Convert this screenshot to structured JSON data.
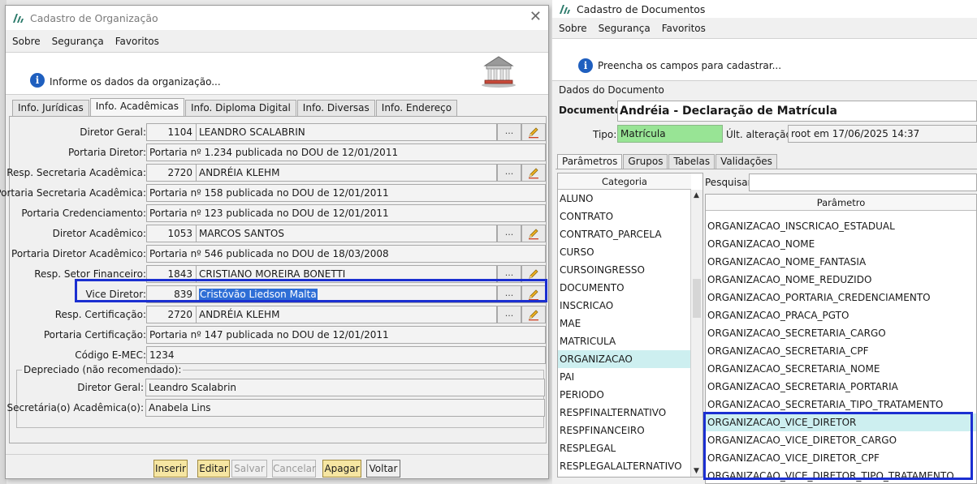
{
  "left_window": {
    "title": "Cadastro de Organização",
    "menu": [
      "Sobre",
      "Segurança",
      "Favoritos"
    ],
    "info_text": "Informe os dados da organização...",
    "tabs": [
      "Info. Jurídicas",
      "Info. Acadêmicas",
      "Info. Diploma Digital",
      "Info. Diversas",
      "Info. Endereço"
    ],
    "active_tab": "Info. Acadêmicas",
    "fields": [
      {
        "label": "Diretor Geral:",
        "code": "1104",
        "value": "LEANDRO SCALABRIN",
        "lookup": true
      },
      {
        "label": "Portaria Diretor:",
        "value": "Portaria nº 1.234 publicada no DOU de 12/01/2011",
        "lookup": false
      },
      {
        "label": "Resp. Secretaria Acadêmica:",
        "code": "2720",
        "value": "ANDRÉIA KLEHM",
        "lookup": true
      },
      {
        "label": "Portaria Secretaria Acadêmica:",
        "value": "Portaria nº 158 publicada no DOU de 12/01/2011",
        "lookup": false
      },
      {
        "label": "Portaria Credenciamento:",
        "value": "Portaria nº 123 publicada no DOU de 12/01/2011",
        "lookup": false
      },
      {
        "label": "Diretor Acadêmico:",
        "code": "1053",
        "value": "MARCOS SANTOS",
        "lookup": true
      },
      {
        "label": "Portaria Diretor Acadêmico:",
        "value": "Portaria nº 546 publicada no DOU de 18/03/2008",
        "lookup": false
      },
      {
        "label": "Resp. Setor Financeiro:",
        "code": "1843",
        "value": "CRISTIANO MOREIRA BONETTI",
        "lookup": true
      },
      {
        "label": "Vice Diretor:",
        "code": "839",
        "value": "Cristóvão Liedson Malta",
        "lookup": true,
        "selected": true
      },
      {
        "label": "Resp. Certificação:",
        "code": "2720",
        "value": "ANDRÉIA KLEHM",
        "lookup": true
      },
      {
        "label": "Portaria Certificação:",
        "value": "Portaria nº 147 publicada no DOU de 12/01/2011",
        "lookup": false
      },
      {
        "label": "Código E-MEC:",
        "value": "1234",
        "lookup": false
      }
    ],
    "lookup_button": "...",
    "deprecated": {
      "title": "Depreciado (não recomendado):",
      "fields": [
        {
          "label": "Diretor Geral:",
          "value": "Leandro Scalabrin"
        },
        {
          "label": "Secretária(o) Acadêmica(o):",
          "value": "Anabela Lins"
        }
      ]
    },
    "buttons": [
      {
        "label": "Inserir",
        "state": "highlight"
      },
      {
        "label": "Editar",
        "state": "highlight"
      },
      {
        "label": "Salvar",
        "state": "disabled"
      },
      {
        "label": "Cancelar",
        "state": "disabled"
      },
      {
        "label": "Apagar",
        "state": "highlight"
      },
      {
        "label": "Voltar",
        "state": "normal"
      }
    ]
  },
  "right_window": {
    "title": "Cadastro de Documentos",
    "menu": [
      "Sobre",
      "Segurança",
      "Favoritos"
    ],
    "info_text": "Preencha os campos para cadastrar...",
    "group_title": "Dados do Documento",
    "documento_label": "Documento:",
    "documento_value": "Andréia - Declaração de Matrícula",
    "tipo_label": "Tipo:",
    "tipo_value": "Matrícula",
    "alteracao_label": "Últ. alteração:",
    "alteracao_value": "root em 17/06/2025 14:37",
    "tabs": [
      "Parâmetros",
      "Grupos",
      "Tabelas",
      "Validações"
    ],
    "active_tab": "Parâmetros",
    "categoria_header": "Categoria",
    "categorias": [
      "ALUNO",
      "CONTRATO",
      "CONTRATO_PARCELA",
      "CURSO",
      "CURSOINGRESSO",
      "DOCUMENTO",
      "INSCRICAO",
      "MAE",
      "MATRICULA",
      "ORGANIZACAO",
      "PAI",
      "PERIODO",
      "RESPFINALTERNATIVO",
      "RESPFINANCEIRO",
      "RESPLEGAL",
      "RESPLEGALALTERNATIVO"
    ],
    "categoria_selected": "ORGANIZACAO",
    "search_label": "Pesquisar:",
    "search_value": "",
    "parametro_header": "Parâmetro",
    "parametros": [
      "ORGANIZACAO_INSCRICAO_ESTADUAL",
      "ORGANIZACAO_NOME",
      "ORGANIZACAO_NOME_FANTASIA",
      "ORGANIZACAO_NOME_REDUZIDO",
      "ORGANIZACAO_PORTARIA_CREDENCIAMENTO",
      "ORGANIZACAO_PRACA_PGTO",
      "ORGANIZACAO_SECRETARIA_CARGO",
      "ORGANIZACAO_SECRETARIA_CPF",
      "ORGANIZACAO_SECRETARIA_NOME",
      "ORGANIZACAO_SECRETARIA_PORTARIA",
      "ORGANIZACAO_SECRETARIA_TIPO_TRATAMENTO",
      "ORGANIZACAO_VICE_DIRETOR",
      "ORGANIZACAO_VICE_DIRETOR_CARGO",
      "ORGANIZACAO_VICE_DIRETOR_CPF",
      "ORGANIZACAO_VICE_DIRETOR_TIPO_TRATAMENTO"
    ],
    "parametro_selected": "ORGANIZACAO_VICE_DIRETOR"
  },
  "colors": {
    "accent_highlight": "#1b2fd1",
    "selection": "#2e6ed6",
    "list_selection": "#cdeff0",
    "tipo_bg": "#98e495",
    "button_yellow": "#f6e6a2"
  }
}
